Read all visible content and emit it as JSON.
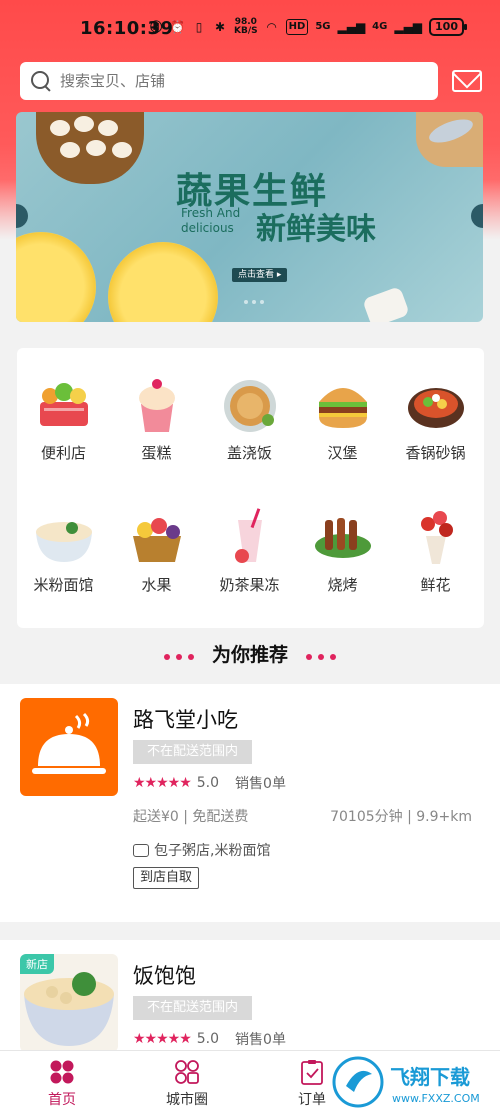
{
  "status_bar": {
    "time": "16:10:39",
    "net_speed": "98.0\nKB/S",
    "hd": "HD",
    "signal1": "5G",
    "signal2": "4G",
    "battery": "100"
  },
  "search": {
    "placeholder": "搜索宝贝、店铺"
  },
  "banner": {
    "title": "蔬果生鲜",
    "english": "Fresh And\ndelicious",
    "subtitle": "新鲜美味",
    "button": "点击查看 ▸"
  },
  "categories": [
    {
      "label": "便利店",
      "icon": "basket-icon"
    },
    {
      "label": "蛋糕",
      "icon": "cupcake-icon"
    },
    {
      "label": "盖浇饭",
      "icon": "pancake-icon"
    },
    {
      "label": "汉堡",
      "icon": "burger-icon"
    },
    {
      "label": "香锅砂锅",
      "icon": "hotpot-icon"
    },
    {
      "label": "米粉面馆",
      "icon": "noodle-bowl-icon"
    },
    {
      "label": "水果",
      "icon": "fruit-basket-icon"
    },
    {
      "label": "奶茶果冻",
      "icon": "milk-tea-icon"
    },
    {
      "label": "烧烤",
      "icon": "bbq-skewer-icon"
    },
    {
      "label": "鲜花",
      "icon": "flower-bouquet-icon"
    }
  ],
  "recommend": {
    "title": "为你推荐"
  },
  "shops": [
    {
      "name": "路飞堂小吃",
      "status": "不在配送范围内",
      "rating": "5.0",
      "sales": "销售0单",
      "fee": "起送¥0 | 免配送费",
      "distance": "70105分钟 | 9.9+km",
      "categories": "包子粥店,米粉面馆",
      "pickup": "到店自取",
      "logo_color": "#ff6b00"
    },
    {
      "name": "饭饱饱",
      "status": "不在配送范围内",
      "rating": "5.0",
      "sales": "销售0单",
      "new_tag": "新店"
    }
  ],
  "nav": [
    {
      "label": "首页",
      "icon": "home-grid-icon",
      "active": true
    },
    {
      "label": "城市圈",
      "icon": "city-circle-icon"
    },
    {
      "label": "订单",
      "icon": "order-clipboard-icon"
    }
  ],
  "watermark": {
    "text": "飞翔下载",
    "url": "www.FXXZ.COM"
  },
  "colors": {
    "header": "#ff4a4a",
    "accent": "#e0245e"
  }
}
